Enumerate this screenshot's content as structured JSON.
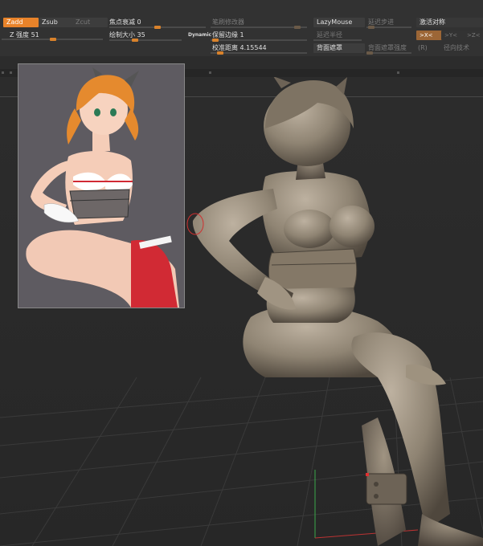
{
  "toolbar": {
    "zadd": "Zadd",
    "zsub": "Zsub",
    "zcut": "Zcut",
    "z_intensity": "Z 强度 51",
    "focal_shift": "焦点衰减 0",
    "draw_size": "绘制大小 35",
    "dynamic": "Dynamic",
    "brush_modifier": "笔刷修改器",
    "keep_edges": "保留边缘 1",
    "calibration_distance": "校准距离 4.15544",
    "lazymouse": "LazyMouse",
    "lazy_step": "延迟步进",
    "lazy_radius": "延迟半径",
    "backface_mask": "背面遮罩",
    "backface_mask_intensity": "背面遮罩强度",
    "activate_symmetry": "激活对称",
    "sym_x": ">X<",
    "sym_y": ">Y<",
    "sym_z": ">Z<",
    "sym_r": "(R)",
    "radial_technique": "径向技术"
  },
  "sliders": {
    "z_intensity": 0.51,
    "focal_shift": 0.5,
    "draw_size": 0.35,
    "keep_edges": 0.05,
    "calibration_distance": 0.1,
    "brush_modifier": 0.9,
    "lazy_step": 0.1,
    "backface_mask_intensity": 0.05
  },
  "colors": {
    "accent": "#e8832a",
    "clay": "#8f8473",
    "background": "#2c2c2c"
  },
  "icons": {
    "ref_image": "reference-image",
    "model": "clay-sculpt-figure"
  }
}
